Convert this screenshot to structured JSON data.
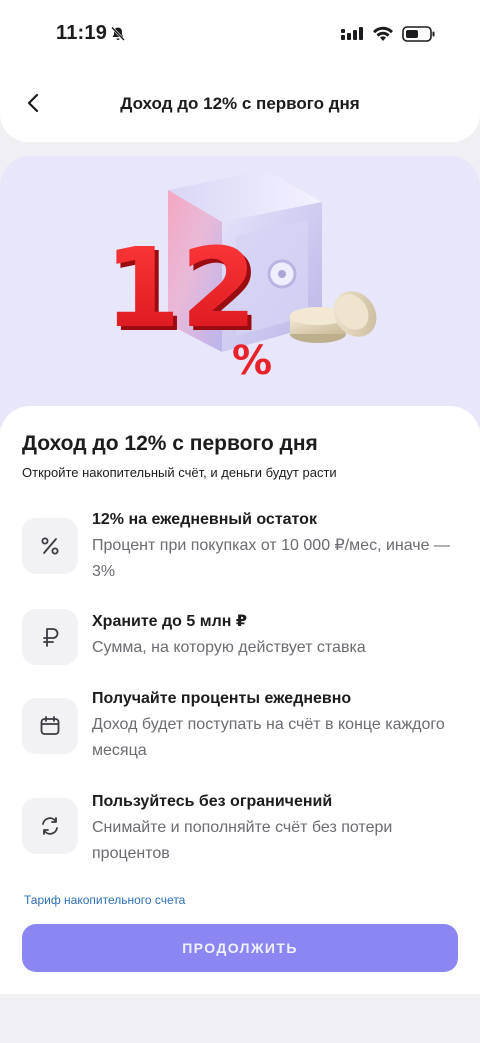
{
  "status_bar": {
    "time": "11:19",
    "icons": [
      "bell-off-icon",
      "signal-icon",
      "wifi-icon",
      "battery-icon"
    ]
  },
  "header": {
    "title": "Доход до 12% с первого дня",
    "back_icon": "chevron-left-icon"
  },
  "hero": {
    "number_text": "12",
    "percent_text": "%"
  },
  "content": {
    "title": "Доход до 12% с первого дня",
    "subtitle": "Откройте накопительный счёт, и деньги будут расти",
    "features": [
      {
        "icon": "percent-icon",
        "title": "12% на ежедневный остаток",
        "description": "Процент при покупках от 10 000 ₽/мес, иначе — 3%"
      },
      {
        "icon": "ruble-icon",
        "title": "Храните до 5 млн ₽",
        "description": "Сумма, на которую действует ставка"
      },
      {
        "icon": "calendar-icon",
        "title": "Получайте проценты ежедневно",
        "description": "Доход будет поступать на счёт в конце каждого месяца"
      },
      {
        "icon": "refresh-icon",
        "title": "Пользуйтесь без ограничений",
        "description": "Снимайте и пополняйте счёт без потери процентов"
      }
    ],
    "tariff_link": "Тариф накопительного счета",
    "continue_button": "ПРОДОЛЖИТЬ"
  },
  "colors": {
    "accent": "#8b87f2",
    "hero_bg": "#e7e6fb",
    "red": "#e8212a",
    "link": "#2c6fb7"
  }
}
